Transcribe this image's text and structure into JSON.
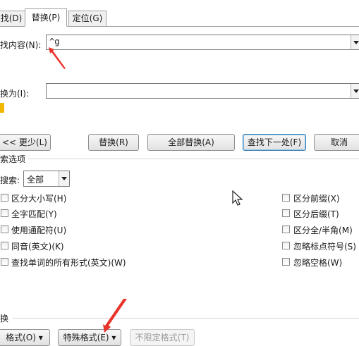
{
  "tabs": [
    {
      "label": "找(D)"
    },
    {
      "label": "替换(P)"
    },
    {
      "label": "定位(G)"
    }
  ],
  "find": {
    "label": "找内容(N):",
    "value": "^g"
  },
  "replace": {
    "label": "换为(I):",
    "value": ""
  },
  "buttons": {
    "less": "<< 更少(L)",
    "replace": "替换(R)",
    "replace_all": "全部替换(A)",
    "find_next": "查找下一处(F)",
    "cancel": "取消"
  },
  "search_options": {
    "title": "索选项",
    "search_label": "搜索:",
    "search_value": "全部"
  },
  "options_left": [
    {
      "label": "区分大小写(H)"
    },
    {
      "label": "全字匹配(Y)"
    },
    {
      "label": "使用通配符(U)"
    },
    {
      "label": "同音(英文)(K)"
    },
    {
      "label": "查找单词的所有形式(英文)(W)"
    }
  ],
  "options_right": [
    {
      "label": "区分前缀(X)"
    },
    {
      "label": "区分后缀(T)"
    },
    {
      "label": "区分全/半角(M)"
    },
    {
      "label": "忽略标点符号(S)"
    },
    {
      "label": "忽略空格(W)"
    }
  ],
  "replace_section": {
    "title": "换"
  },
  "bottom_buttons": {
    "format": "格式(O) ▾",
    "special": "特殊格式(E) ▾",
    "no_format": "不限定格式(T)"
  },
  "colors": {
    "annotation_arrow": "#e8342a"
  }
}
